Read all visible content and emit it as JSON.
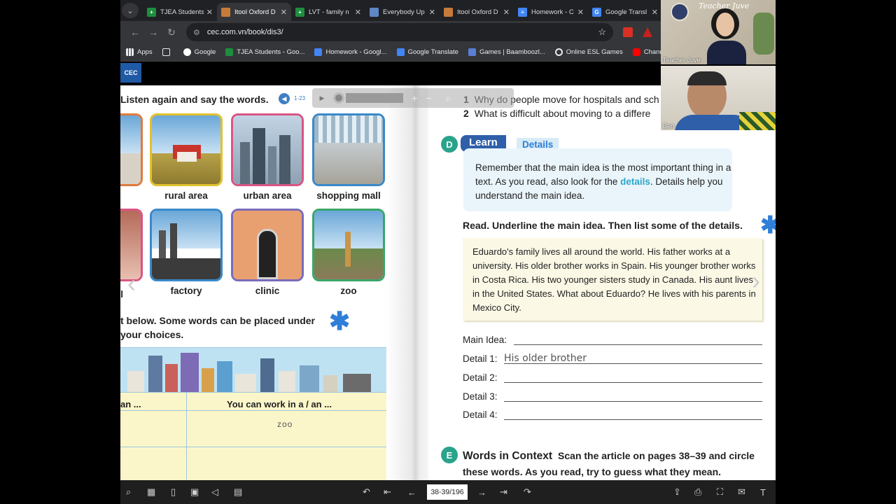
{
  "tabs": [
    {
      "label": "TJEA Students",
      "color": "#1e8e3e",
      "glyph": "+"
    },
    {
      "label": "Itool Oxford D",
      "color": "#c77b3b",
      "glyph": "",
      "active": true
    },
    {
      "label": "LVT - family n",
      "color": "#1e8e3e",
      "glyph": "+"
    },
    {
      "label": "Everybody Up",
      "color": "#5f86c5",
      "glyph": ""
    },
    {
      "label": "Itool Oxford D",
      "color": "#c77b3b",
      "glyph": ""
    },
    {
      "label": "Homework - C",
      "color": "#4285f4",
      "glyph": "≡"
    },
    {
      "label": "Google Transl",
      "color": "#4285f4",
      "glyph": "G"
    }
  ],
  "address": {
    "url": "cec.com.vn/book/dis3/"
  },
  "bookmarks": [
    {
      "label": "Apps",
      "color": "#e8eaed"
    },
    {
      "label": "",
      "color": "#e8eaed"
    },
    {
      "label": "Google",
      "color": "#fbbc04"
    },
    {
      "label": "TJEA Students - Goo...",
      "color": "#1e8e3e"
    },
    {
      "label": "Homework - Googl...",
      "color": "#4285f4"
    },
    {
      "label": "Google Translate",
      "color": "#4285f4"
    },
    {
      "label": "Games | Baamboozl...",
      "color": "#8e44ad"
    },
    {
      "label": "Online ESL Games",
      "color": "#e8eaed"
    },
    {
      "label": "Channel content - Y...",
      "color": "#ff0000"
    }
  ],
  "site": {
    "logo": "CEC"
  },
  "left_page": {
    "heading": "Listen again and say the words.",
    "track": "1-23",
    "pictures": [
      {
        "label": "rural area",
        "border": "#e2c12e"
      },
      {
        "label": "urban area",
        "border": "#d95585"
      },
      {
        "label": "shopping mall",
        "border": "#3a89c9"
      },
      {
        "label": "factory",
        "border": "#3a89c9"
      },
      {
        "label": "clinic",
        "border": "#7b6bb8"
      },
      {
        "label": "zoo",
        "border": "#3aa66a"
      }
    ],
    "partial_labels": [
      "l"
    ],
    "instruction_line1": "t below. Some words can be placed under",
    "instruction_line2": "your choices.",
    "table": {
      "col1": "an ...",
      "col2": "You can work in a / an ...",
      "entry": "zoo"
    }
  },
  "right_page": {
    "questions": [
      {
        "num": "1",
        "text": "Why do people move for hospitals and sch"
      },
      {
        "num": "2",
        "text": "What is difficult about moving to a differe"
      }
    ],
    "section_d": {
      "badge": "D",
      "learn": "Learn",
      "tag": "Details",
      "box_pre": "Remember that the main idea is the most important thing in a text. As you read, also look for the ",
      "box_hl": "details",
      "box_post": ". Details help you understand the main idea."
    },
    "read_instruction": "Read. Underline the main idea. Then list some of the details.",
    "passage": "Eduardo's family lives all around the world. His father works at a university. His older brother works in Spain. His younger brother works in Costa Rica. His two younger sisters study in Canada. His aunt lives in the United States. What about Eduardo? He lives with his parents in Mexico City.",
    "details": [
      {
        "label": "Main Idea:",
        "value": ""
      },
      {
        "label": "Detail 1:",
        "value": "His older brother"
      },
      {
        "label": "Detail 2:",
        "value": ""
      },
      {
        "label": "Detail 3:",
        "value": ""
      },
      {
        "label": "Detail 4:",
        "value": ""
      }
    ],
    "section_e": {
      "badge": "E",
      "title": "Words in Context",
      "text": "Scan the article on pages 38–39 and circle these words. As you read, try to guess what they mean."
    }
  },
  "reader_toolbar": {
    "page": "38-39/196"
  },
  "video": [
    {
      "name": "Teacher Juve",
      "banner": "Teacher Juve"
    },
    {
      "name": "Ben"
    }
  ]
}
